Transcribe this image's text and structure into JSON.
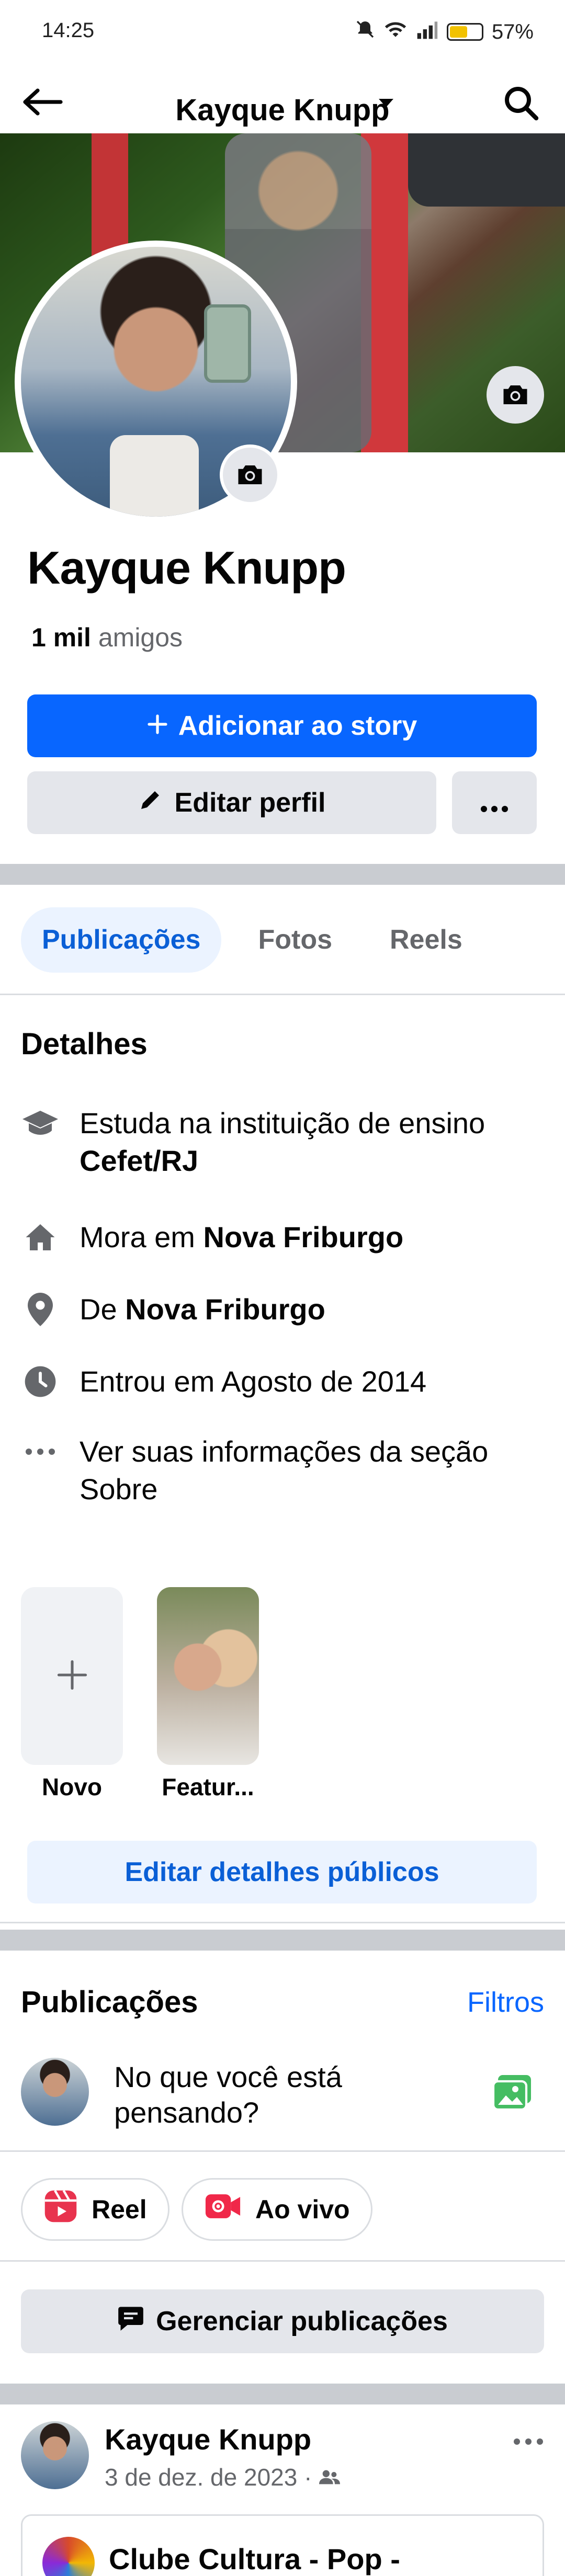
{
  "status_bar": {
    "time": "14:25",
    "battery": "57%"
  },
  "header": {
    "title": "Kayque Knupp"
  },
  "profile": {
    "name": "Kayque Knupp",
    "friends_count": "1 mil",
    "friends_label": "amigos"
  },
  "actions": {
    "add_story": "Adicionar ao story",
    "edit_profile": "Editar perfil"
  },
  "tabs": [
    {
      "label": "Publicações",
      "active": true
    },
    {
      "label": "Fotos",
      "active": false
    },
    {
      "label": "Reels",
      "active": false
    }
  ],
  "details": {
    "title": "Detalhes",
    "study_prefix": "Estuda na instituição de ensino",
    "study_place": "Cefet/RJ",
    "lives_prefix": "Mora em",
    "lives_place": "Nova Friburgo",
    "from_prefix": "De",
    "from_place": "Nova Friburgo",
    "joined": "Entrou em Agosto de 2014",
    "see_about": "Ver suas informações da seção Sobre"
  },
  "highlights": [
    {
      "label": "Novo"
    },
    {
      "label": "Featur..."
    }
  ],
  "edit_public_details": "Editar detalhes públicos",
  "posts": {
    "title": "Publicações",
    "filters": "Filtros",
    "composer_placeholder": "No que você está pensando?",
    "reel_label": "Reel",
    "live_label": "Ao vivo",
    "manage_label": "Gerenciar publicações"
  },
  "post": {
    "author": "Kayque Knupp",
    "date": "3 de dez. de 2023 ·",
    "shared_page": "Clube Cultura - Pop -"
  },
  "colors": {
    "brand_blue": "#0866ff",
    "tab_active_bg": "#ebf3ff",
    "button_gray": "#e4e6eb"
  }
}
